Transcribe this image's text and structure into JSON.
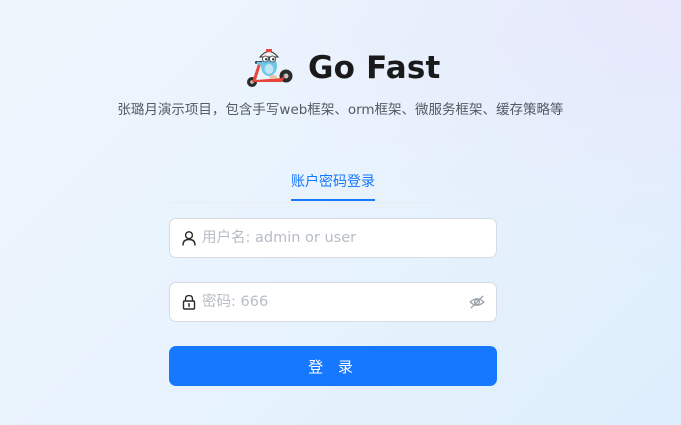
{
  "app": {
    "title": "Go Fast",
    "subtitle": "张璐月演示项目，包含手写web框架、orm框架、微服务框架、缓存策略等",
    "logo_icon": "gopher-scooter-logo"
  },
  "login": {
    "tab_label": "账户密码登录",
    "username": {
      "value": "",
      "placeholder": "用户名: admin or user",
      "icon": "user-icon"
    },
    "password": {
      "value": "",
      "placeholder": "密码: 666",
      "icon": "lock-icon",
      "toggle_icon": "eye-invisible-icon"
    },
    "submit_label": "登 录"
  },
  "colors": {
    "primary": "#1677ff",
    "background": "#e9f3fd",
    "border": "#d6dbe2"
  }
}
